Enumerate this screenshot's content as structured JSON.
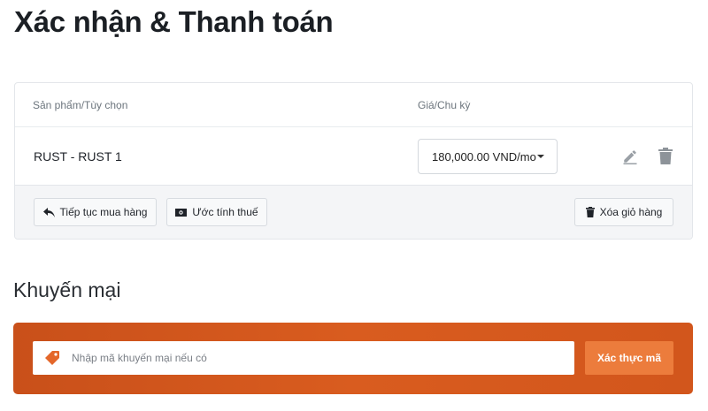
{
  "page": {
    "title": "Xác nhận & Thanh toán"
  },
  "cart": {
    "headers": {
      "product": "Sản phẩm/Tùy chọn",
      "price": "Giá/Chu kỳ"
    },
    "items": [
      {
        "name": "RUST - RUST 1",
        "price": "180,000.00 VND/mo"
      }
    ],
    "buttons": {
      "continue": "Tiếp tục mua hàng",
      "estimate_tax": "Ước tính thuế",
      "empty_cart": "Xóa giỏ hàng"
    }
  },
  "promo": {
    "title": "Khuyến mại",
    "placeholder": "Nhập mã khuyến mại nếu có",
    "value": "",
    "button": "Xác thực mã"
  },
  "colors": {
    "promo_bg": "#d4561c",
    "verify_button": "#ec7c3c",
    "tag_icon": "#e4672a"
  },
  "icons": [
    "edit-icon",
    "trash-icon",
    "reply-icon",
    "money-icon",
    "tag-icon",
    "caret-down-icon"
  ]
}
